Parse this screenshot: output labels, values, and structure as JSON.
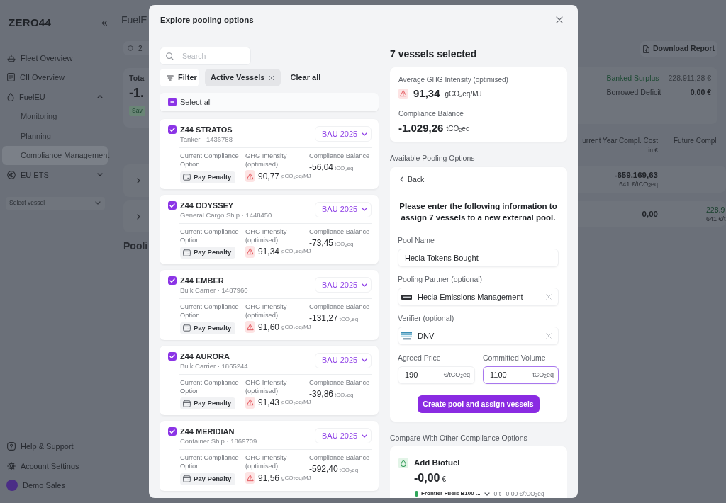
{
  "sidebar": {
    "logo": "ZERO44",
    "nav": [
      {
        "label": "Fleet Overview",
        "selected": false
      },
      {
        "label": "CII Overview",
        "selected": false
      },
      {
        "label": "FuelEU",
        "selected": false,
        "expanded": true,
        "children": [
          {
            "label": "Monitoring",
            "selected": false
          },
          {
            "label": "Planning",
            "selected": false
          },
          {
            "label": "Compliance Management",
            "selected": true
          }
        ]
      },
      {
        "label": "EU ETS",
        "selected": false,
        "expanded": false
      }
    ],
    "vessel_select": {
      "placeholder": "Select vessel"
    },
    "footer": [
      {
        "label": "Help & Support"
      },
      {
        "label": "Account Settings"
      }
    ],
    "user": {
      "name": "Demo Sales"
    }
  },
  "page": {
    "title": "FuelE",
    "year_chip": "2",
    "summary": {
      "label": "Tota",
      "value": "-1.",
      "badge": "Sav"
    },
    "section_title": "Pooli",
    "download_button": "Download Report",
    "balances": [
      {
        "label": "Banked Surplus",
        "value": "228.911,28 €",
        "kind": "surplus"
      },
      {
        "label": "Borrowed Deficit",
        "value": "0,00 €",
        "kind": "deficit"
      }
    ],
    "table": {
      "columns": [
        {
          "label": "urrent Year Compl. Cost",
          "unit": "in €"
        },
        {
          "label": "Future Compl"
        }
      ],
      "rows": [
        {
          "cells": [
            {
              "value": "-659.169,63",
              "sub": "641 €/tCO$_{2}$eq",
              "positive": false
            }
          ]
        },
        {
          "cells": [
            {
              "value": "0,00",
              "positive": false
            },
            {
              "value": "228.9",
              "sub": "641 €/t",
              "positive": true
            }
          ]
        }
      ]
    }
  },
  "modal": {
    "title": "Explore pooling options",
    "search": {
      "placeholder": "Search"
    },
    "filter_button": "Filter",
    "chips": [
      {
        "label": "Active Vessels"
      }
    ],
    "clear_all": "Clear all",
    "select_all": {
      "label": "Select all",
      "indeterminate": true
    },
    "vessels": [
      {
        "name": "Z44 STRATOS",
        "info": "Tanker · 1436788",
        "checked": true,
        "scenario": "BAU 2025",
        "option_label": "Current Compliance Option",
        "option": "Pay Penalty",
        "ghg_label": "GHG Intensity (optimised)",
        "ghg": "90,77",
        "ghg_unit": "gCO$_{2}$eq/MJ",
        "ghg_warning": true,
        "balance_label": "Compliance Balance",
        "balance": "-56,04",
        "balance_unit": "tCO$_{2}$eq"
      },
      {
        "name": "Z44 ODYSSEY",
        "info": "General Cargo Ship · 1448450",
        "checked": true,
        "scenario": "BAU 2025",
        "option_label": "Current Compliance Option",
        "option": "Pay Penalty",
        "ghg_label": "GHG Intensity (optimised)",
        "ghg": "91,34",
        "ghg_unit": "gCO$_{2}$eq/MJ",
        "ghg_warning": true,
        "balance_label": "Compliance Balance",
        "balance": "-73,45",
        "balance_unit": "tCO$_{2}$eq"
      },
      {
        "name": "Z44 EMBER",
        "info": "Bulk Carrier · 1487960",
        "checked": true,
        "scenario": "BAU 2025",
        "option_label": "Current Compliance Option",
        "option": "Pay Penalty",
        "ghg_label": "GHG Intensity (optimised)",
        "ghg": "91,60",
        "ghg_unit": "gCO$_{2}$eq/MJ",
        "ghg_warning": true,
        "balance_label": "Compliance Balance",
        "balance": "-131,27",
        "balance_unit": "tCO$_{2}$eq"
      },
      {
        "name": "Z44 AURORA",
        "info": "Bulk Carrier · 1865244",
        "checked": true,
        "scenario": "BAU 2025",
        "option_label": "Current Compliance Option",
        "option": "Pay Penalty",
        "ghg_label": "GHG Intensity (optimised)",
        "ghg": "91,43",
        "ghg_unit": "gCO$_{2}$eq/MJ",
        "ghg_warning": true,
        "balance_label": "Compliance Balance",
        "balance": "-39,86",
        "balance_unit": "tCO$_{2}$eq"
      },
      {
        "name": "Z44 MERIDIAN",
        "info": "Container Ship · 1869709",
        "checked": true,
        "scenario": "BAU 2025",
        "option_label": "Current Compliance Option",
        "option": "Pay Penalty",
        "ghg_label": "GHG Intensity (optimised)",
        "ghg": "91,56",
        "ghg_unit": "gCO$_{2}$eq/MJ",
        "ghg_warning": true,
        "balance_label": "Compliance Balance",
        "balance": "-592,40",
        "balance_unit": "tCO$_{2}$eq"
      }
    ],
    "summary": {
      "title": "7 vessels selected",
      "avg_label": "Average GHG Intensity (optimised)",
      "avg": "91,34",
      "avg_unit": "gCO$_{2}$eq/MJ",
      "avg_warning": true,
      "balance_label": "Compliance Balance",
      "balance": "-1.029,26",
      "balance_unit": "tCO$_{2}$eq"
    },
    "pooling": {
      "section": "Available Pooling Options",
      "back": "Back",
      "heading": "Please enter the following information to assign 7 vessels to a new external pool.",
      "fields": [
        {
          "kind": "text",
          "label": "Pool Name",
          "value": "Hecla Tokens Bought"
        },
        {
          "kind": "select",
          "label": "Pooling Partner (optional)",
          "value": "Hecla Emissions Management"
        },
        {
          "kind": "select",
          "label": "Verifier (optional)",
          "value": "DNV"
        }
      ],
      "inputs": [
        {
          "label": "Agreed Price",
          "value": "190",
          "unit": "€/tCO$_{2}$eq",
          "focused": false
        },
        {
          "label": "Committed Volume",
          "value": "1100",
          "unit": "tCO$_{2}$eq",
          "focused": true
        }
      ],
      "submit": "Create pool and assign vessels"
    },
    "compare": {
      "section": "Compare With Other Compliance Options",
      "options": [
        {
          "title": "Add Biofuel",
          "amount": "-0,00",
          "currency": "€",
          "fuel": {
            "name": "Frontier Fuels B100 ...",
            "color": "#2fa65a",
            "detail": "0 t · 0,00 €/tCO$_{2}$eq"
          }
        }
      ]
    }
  }
}
